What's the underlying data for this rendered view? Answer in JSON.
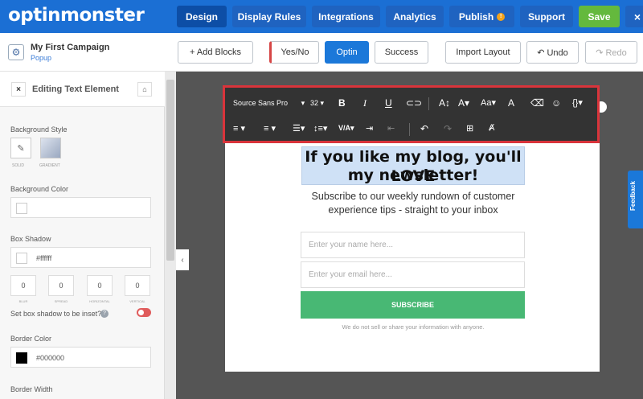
{
  "logo": {
    "text_a": "optinm",
    "text_m": "o",
    "text_b": "nster"
  },
  "nav": {
    "design": "Design",
    "display_rules": "Display Rules",
    "integrations": "Integrations",
    "analytics": "Analytics",
    "publish": "Publish",
    "support": "Support",
    "save": "Save",
    "close": "×"
  },
  "campaign": {
    "name": "My First Campaign",
    "type": "Popup"
  },
  "toolbar_buttons": {
    "add_blocks": "+ Add Blocks",
    "yesno": "Yes/No",
    "optin": "Optin",
    "success": "Success",
    "import_layout": "Import Layout",
    "undo": "↶ Undo",
    "redo": "↷ Redo"
  },
  "panel": {
    "title": "Editing Text Element",
    "background_style": "Background Style",
    "solid": "SOLID",
    "gradient": "GRADIENT",
    "background_color": "Background Color",
    "box_shadow": "Box Shadow",
    "box_shadow_value": "#ffffff",
    "shadow_values": [
      "0",
      "0",
      "0",
      "0"
    ],
    "shadow_caps": [
      "BLUR",
      "SPREAD",
      "HORIZONTAL",
      "VERTICAL"
    ],
    "inset_label": "Set box shadow to be inset?",
    "border_color": "Border Color",
    "border_color_value": "#000000",
    "border_width": "Border Width"
  },
  "editor": {
    "font": "Source Sans Pro",
    "size": "32"
  },
  "popup": {
    "headline_1": "If you like my blog, you'll LOVE",
    "headline_2": "my newsletter!",
    "sub_1": "Subscribe to our weekly rundown of customer",
    "sub_2": "experience tips - straight to your inbox",
    "name_placeholder": "Enter your name here...",
    "email_placeholder": "Enter your email here...",
    "subscribe": "SUBSCRIBE",
    "privacy": "We do not sell or share your information with anyone."
  },
  "feedback": "Feedback",
  "colors": {
    "brand": "#1b6fd4",
    "save": "#64b93d",
    "subscribe": "#48b874",
    "highlight": "#d9343b"
  }
}
